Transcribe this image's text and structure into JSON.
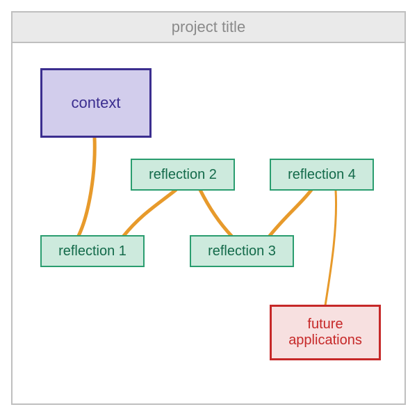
{
  "title": "project title",
  "nodes": {
    "context": "context",
    "reflection1": "reflection 1",
    "reflection2": "reflection 2",
    "reflection3": "reflection 3",
    "reflection4": "reflection 4",
    "future": "future applications"
  },
  "connections": [
    [
      "context",
      "reflection1"
    ],
    [
      "reflection1",
      "reflection2"
    ],
    [
      "reflection2",
      "reflection3"
    ],
    [
      "reflection3",
      "reflection4"
    ],
    [
      "reflection4",
      "future"
    ]
  ],
  "colors": {
    "connector": "#e79a2b",
    "context_fill": "#d2cdec",
    "context_border": "#3b2e8f",
    "reflection_fill": "#cdeadd",
    "reflection_border": "#2a9d6f",
    "future_fill": "#f7e0e0",
    "future_border": "#c62828",
    "titlebar_bg": "#eaeaea",
    "titlebar_text": "#8a8a8a"
  }
}
